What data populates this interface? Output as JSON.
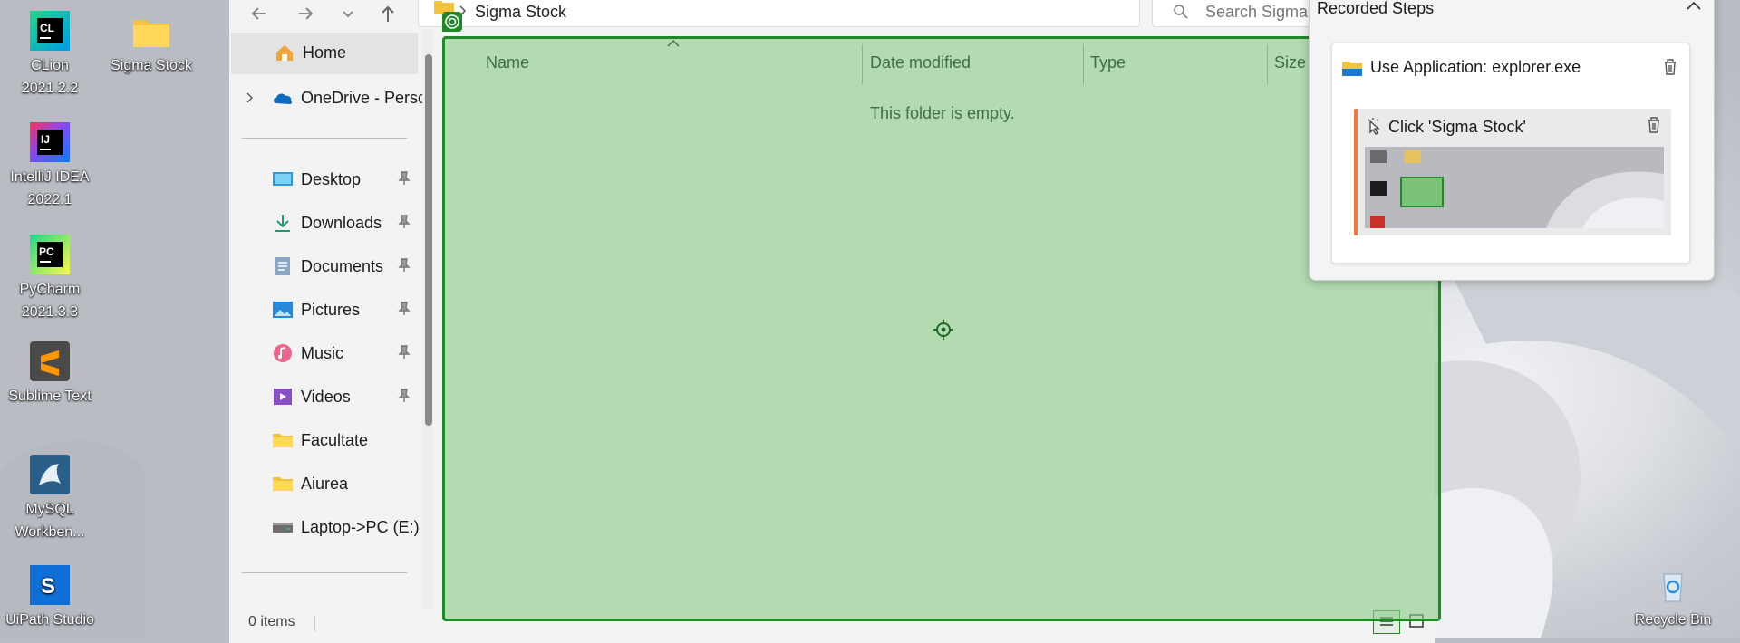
{
  "desktop": {
    "icons": [
      {
        "label_line1": "CLion",
        "label_line2": "2021.2.2"
      },
      {
        "label_line1": "Sigma Stock",
        "label_line2": ""
      },
      {
        "label_line1": "IntelliJ IDEA",
        "label_line2": "2022.1"
      },
      {
        "label_line1": "PyCharm",
        "label_line2": "2021.3.3"
      },
      {
        "label_line1": "Sublime Text",
        "label_line2": ""
      },
      {
        "label_line1": "MySQL",
        "label_line2": "Workben..."
      },
      {
        "label_line1": "UiPath Studio",
        "label_line2": ""
      },
      {
        "label_line1": "Recycle Bin",
        "label_line2": ""
      }
    ]
  },
  "explorer": {
    "address_crumb": "Sigma Stock",
    "search_placeholder": "Search Sigma",
    "sidebar": {
      "items": [
        {
          "label": "Home",
          "icon": "home-icon"
        },
        {
          "label": "OneDrive - Perso",
          "icon": "onedrive-icon"
        },
        {
          "label": "Desktop",
          "icon": "desktop-icon",
          "pinned": true
        },
        {
          "label": "Downloads",
          "icon": "downloads-icon",
          "pinned": true
        },
        {
          "label": "Documents",
          "icon": "documents-icon",
          "pinned": true
        },
        {
          "label": "Pictures",
          "icon": "pictures-icon",
          "pinned": true
        },
        {
          "label": "Music",
          "icon": "music-icon",
          "pinned": true
        },
        {
          "label": "Videos",
          "icon": "videos-icon",
          "pinned": true
        },
        {
          "label": "Facultate",
          "icon": "folder-icon"
        },
        {
          "label": "Aiurea",
          "icon": "folder-icon"
        },
        {
          "label": "Laptop->PC (E:)",
          "icon": "drive-icon"
        }
      ]
    },
    "columns": {
      "name": "Name",
      "date_modified": "Date modified",
      "type": "Type",
      "size": "Size"
    },
    "empty_message": "This folder is empty.",
    "status_items": "0 items"
  },
  "recorded_steps": {
    "title": "Recorded Steps",
    "step_app": "Use Application: explorer.exe",
    "step_click": "Click 'Sigma Stock'"
  },
  "colors": {
    "highlight_fill": "#8ac988",
    "highlight_border": "#1e8a25",
    "step_accent": "#f07a3d"
  }
}
